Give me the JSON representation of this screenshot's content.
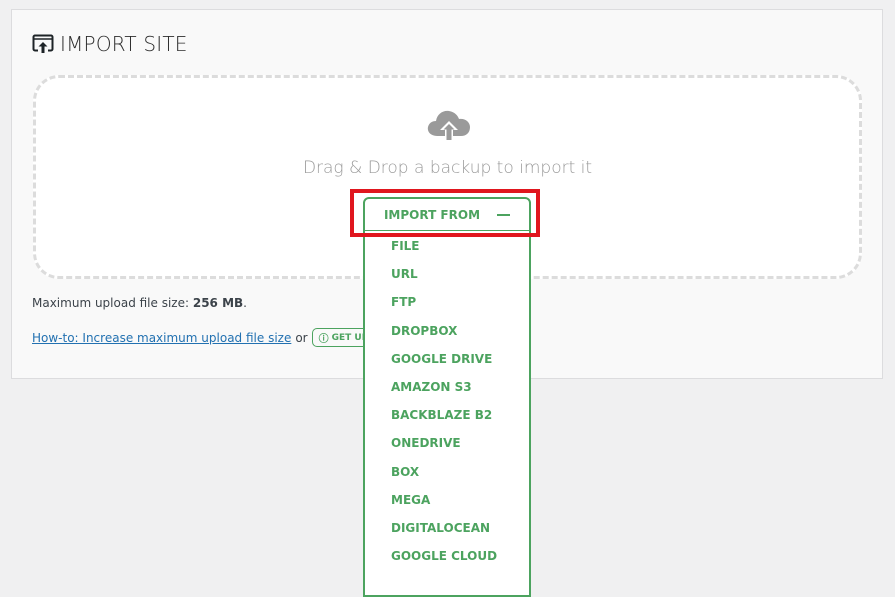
{
  "panel": {
    "title": "IMPORT SITE",
    "title_icon": "import-window-icon"
  },
  "dropzone": {
    "icon": "cloud-upload-icon",
    "text": "Drag & Drop a backup to import it"
  },
  "import_from": {
    "label": "IMPORT FROM",
    "toggle_icon": "minus-icon",
    "options": [
      "FILE",
      "URL",
      "FTP",
      "DROPBOX",
      "GOOGLE DRIVE",
      "AMAZON S3",
      "BACKBLAZE B2",
      "ONEDRIVE",
      "BOX",
      "MEGA",
      "DIGITALOCEAN",
      "GOOGLE CLOUD"
    ]
  },
  "upload_info": {
    "prefix": "Maximum upload file size: ",
    "value": "256 MB",
    "suffix": "."
  },
  "help": {
    "link_text": "How-to: Increase maximum upload file size",
    "or_text": "or",
    "unlimited_icon": "info-circle-icon",
    "unlimited_label": "GET UNLIMITED"
  },
  "colors": {
    "accent_green": "#4ca35f",
    "highlight_red": "#e0161e",
    "link_blue": "#2271b1"
  }
}
